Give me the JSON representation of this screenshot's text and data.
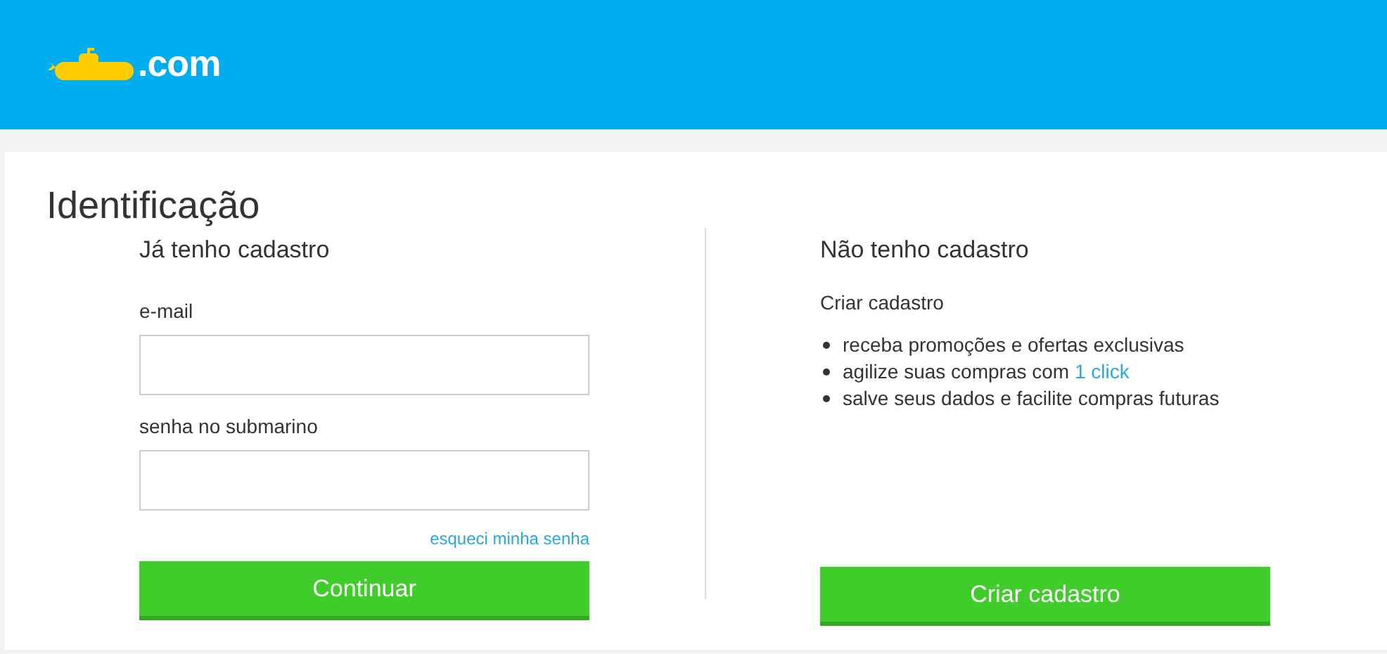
{
  "header": {
    "logo_text": ".com"
  },
  "page_title": "Identificação",
  "login": {
    "heading": "Já tenho cadastro",
    "fields": [
      {
        "label": "e-mail"
      },
      {
        "label": "senha no submarino"
      }
    ],
    "forgot_link": "esqueci minha senha",
    "submit": "Continuar"
  },
  "signup": {
    "heading": "Não tenho cadastro",
    "subheading": "Criar cadastro",
    "benefits": [
      {
        "text": "receba promoções e ofertas exclusivas"
      },
      {
        "text": "agilize suas compras com",
        "link": "1 click"
      },
      {
        "text": "salve seus dados e facilite compras futuras"
      }
    ],
    "submit": "Criar cadastro"
  }
}
